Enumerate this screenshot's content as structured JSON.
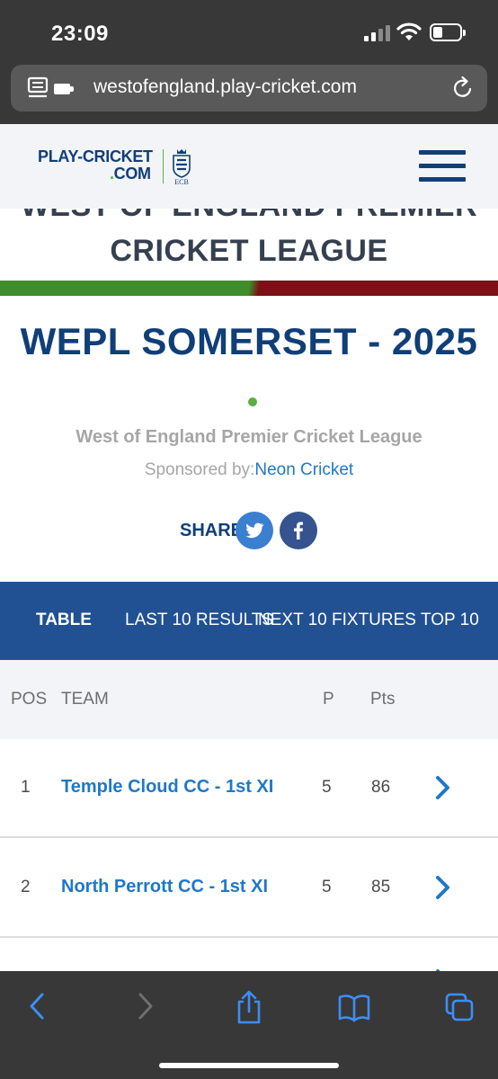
{
  "status_bar": {
    "time": "23:09"
  },
  "browser": {
    "url": "westofengland.play-cricket.com"
  },
  "header": {
    "logo_line1": "PLAY-CRICKET",
    "logo_line2_dot": ".",
    "logo_line2": "COM",
    "ecb_label": "ECB"
  },
  "league": {
    "title_line1": "WEST OF ENGLAND PREMIER",
    "title_line2": "CRICKET LEAGUE"
  },
  "competition": {
    "title": "WEPL SOMERSET - 2025",
    "league_name": "West of England Premier Cricket League",
    "sponsored_by_label": "Sponsored by:",
    "sponsor_name": "Neon Cricket",
    "share_label": "SHARE"
  },
  "tabs": [
    {
      "label": "TABLE",
      "active": true
    },
    {
      "label": "LAST 10 RESULTS",
      "active": false
    },
    {
      "label": "NEXT 10 FIXTURES",
      "active": false
    },
    {
      "label": "TOP 10",
      "active": false
    }
  ],
  "table": {
    "headers": {
      "pos": "POS",
      "team": "TEAM",
      "p": "P",
      "pts": "Pts"
    },
    "rows": [
      {
        "pos": "1",
        "team": "Temple Cloud CC - 1st XI",
        "p": "5",
        "pts": "86"
      },
      {
        "pos": "2",
        "team": "North Perrott CC - 1st XI",
        "p": "5",
        "pts": "85"
      }
    ]
  },
  "colors": {
    "navy": "#103f78",
    "tab_bar": "#215193",
    "link_blue": "#1f78c8",
    "green": "#5ab043",
    "maroon": "#7b1016",
    "browser_chrome": "#383838"
  },
  "icons": {
    "url_left": "reader-icon",
    "reload": "reload-icon",
    "share_twitter": "twitter-icon",
    "share_facebook": "facebook-icon",
    "row_action": "chevron-right-icon",
    "toolbar": [
      "back-icon",
      "forward-icon",
      "share-icon",
      "bookmarks-icon",
      "tabs-icon"
    ]
  },
  "battery_level": 0.35
}
